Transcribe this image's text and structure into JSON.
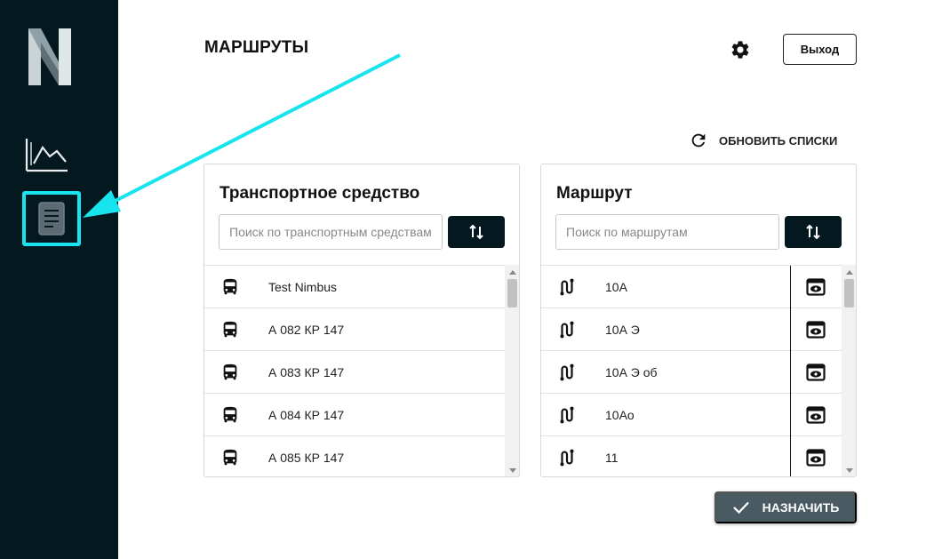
{
  "header": {
    "title": "МАРШРУТЫ",
    "logout_label": "Выход"
  },
  "toolbar": {
    "refresh_label": "ОБНОВИТЬ СПИСКИ"
  },
  "vehicles": {
    "title": "Транспортное средство",
    "search_placeholder": "Поиск по транспортным средствам",
    "items": [
      {
        "label": "Test Nimbus"
      },
      {
        "label": "А 082 КР 147"
      },
      {
        "label": "А 083 КР 147"
      },
      {
        "label": "А 084 КР 147"
      },
      {
        "label": "А 085 КР 147"
      }
    ]
  },
  "routes": {
    "title": "Маршрут",
    "search_placeholder": "Поиск по маршрутам",
    "items": [
      {
        "label": "10А"
      },
      {
        "label": "10А Э"
      },
      {
        "label": "10А Э об"
      },
      {
        "label": "10Ао"
      },
      {
        "label": "11"
      }
    ]
  },
  "footer": {
    "assign_label": "НАЗНАЧИТЬ"
  },
  "colors": {
    "sidebar_bg": "#04181f",
    "highlight": "#17e4ee",
    "assign_bg": "#4a5a62"
  },
  "icons": {
    "logo": "n-logo-icon",
    "nav_chart": "chart-icon",
    "nav_routes": "document-icon",
    "settings": "gear-icon",
    "refresh": "refresh-icon",
    "sort": "sort-arrows-icon",
    "vehicle": "bus-icon",
    "route": "route-icon",
    "view": "eye-icon",
    "assign": "check-icon"
  }
}
